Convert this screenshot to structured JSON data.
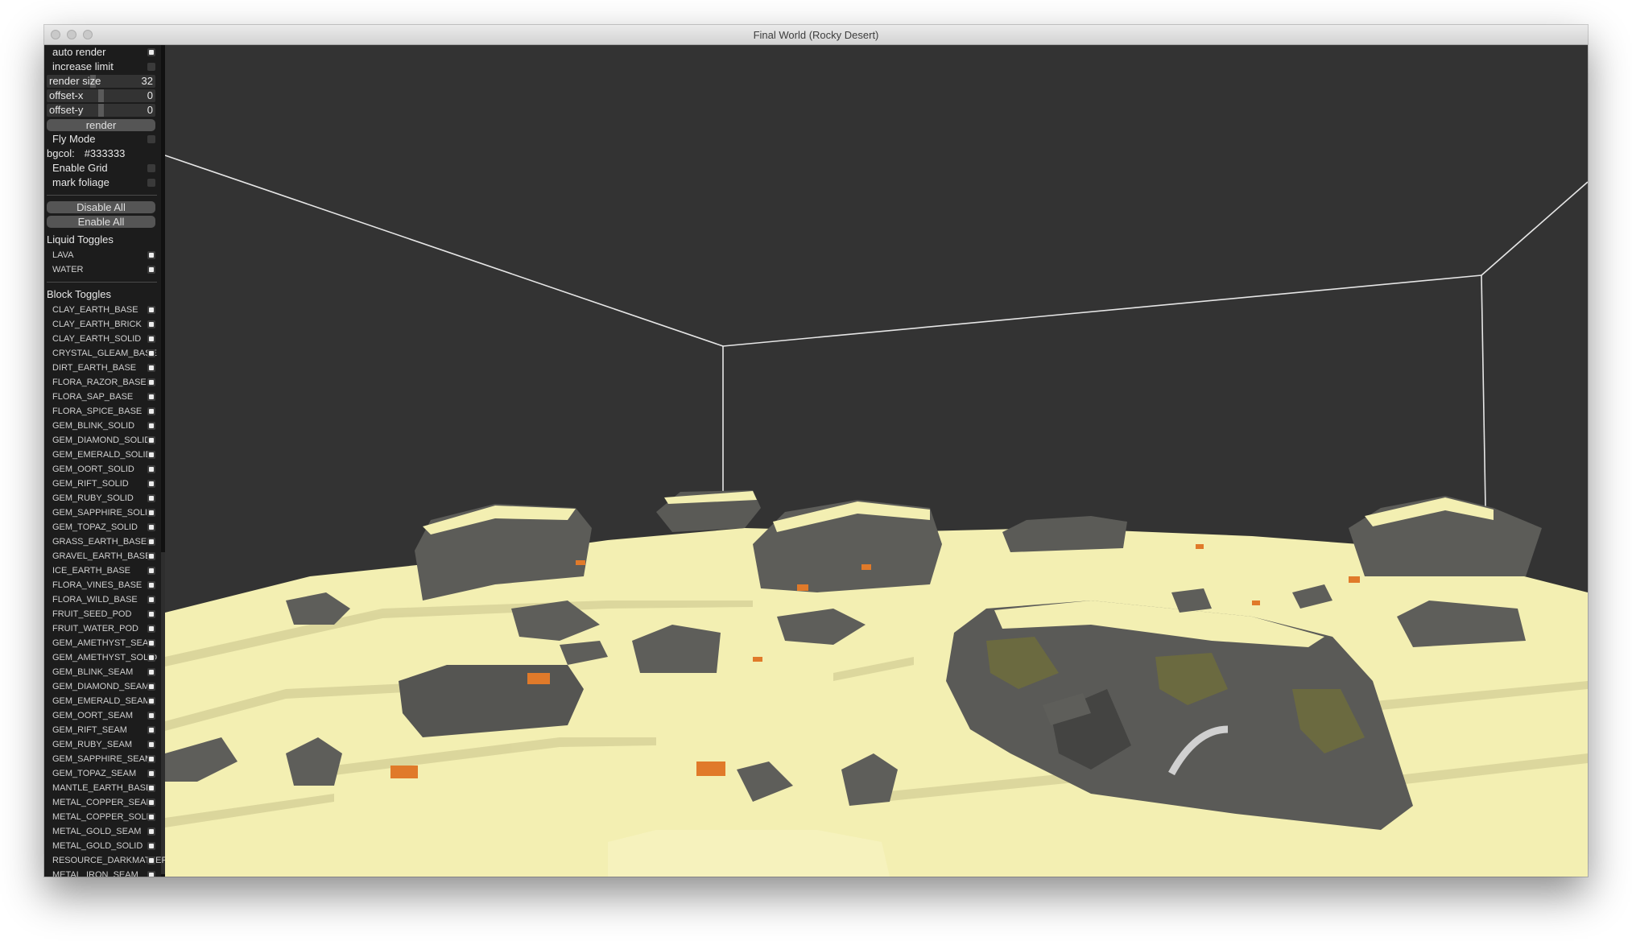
{
  "window": {
    "title": "Final World (Rocky Desert)"
  },
  "controls": {
    "auto_render": {
      "label": "auto render",
      "checked": true
    },
    "increase_limit": {
      "label": "increase limit",
      "checked": false
    },
    "render_size": {
      "label": "render size",
      "value": "32"
    },
    "offset_x": {
      "label": "offset-x",
      "value": "0"
    },
    "offset_y": {
      "label": "offset-y",
      "value": "0"
    },
    "render_button": "render",
    "fly_mode": {
      "label": "Fly Mode",
      "checked": false
    },
    "bgcol": {
      "label": "bgcol:",
      "value": "#333333"
    },
    "enable_grid": {
      "label": "Enable Grid",
      "checked": false
    },
    "mark_foliage": {
      "label": "mark foliage",
      "checked": false
    },
    "disable_all": "Disable All",
    "enable_all": "Enable All"
  },
  "liquid_toggles": {
    "heading": "Liquid Toggles",
    "items": [
      {
        "label": "LAVA",
        "checked": true
      },
      {
        "label": "WATER",
        "checked": true
      }
    ]
  },
  "block_toggles": {
    "heading": "Block Toggles",
    "items": [
      {
        "label": "CLAY_EARTH_BASE",
        "checked": true
      },
      {
        "label": "CLAY_EARTH_BRICK",
        "checked": true
      },
      {
        "label": "CLAY_EARTH_SOLID",
        "checked": true
      },
      {
        "label": "CRYSTAL_GLEAM_BASE",
        "checked": true
      },
      {
        "label": "DIRT_EARTH_BASE",
        "checked": true
      },
      {
        "label": "FLORA_RAZOR_BASE",
        "checked": true
      },
      {
        "label": "FLORA_SAP_BASE",
        "checked": true
      },
      {
        "label": "FLORA_SPICE_BASE",
        "checked": true
      },
      {
        "label": "GEM_BLINK_SOLID",
        "checked": true
      },
      {
        "label": "GEM_DIAMOND_SOLID",
        "checked": true
      },
      {
        "label": "GEM_EMERALD_SOLID",
        "checked": true
      },
      {
        "label": "GEM_OORT_SOLID",
        "checked": true
      },
      {
        "label": "GEM_RIFT_SOLID",
        "checked": true
      },
      {
        "label": "GEM_RUBY_SOLID",
        "checked": true
      },
      {
        "label": "GEM_SAPPHIRE_SOLID",
        "checked": true
      },
      {
        "label": "GEM_TOPAZ_SOLID",
        "checked": true
      },
      {
        "label": "GRASS_EARTH_BASE",
        "checked": true
      },
      {
        "label": "GRAVEL_EARTH_BASE",
        "checked": true
      },
      {
        "label": "ICE_EARTH_BASE",
        "checked": true
      },
      {
        "label": "FLORA_VINES_BASE",
        "checked": true
      },
      {
        "label": "FLORA_WILD_BASE",
        "checked": true
      },
      {
        "label": "FRUIT_SEED_POD",
        "checked": true
      },
      {
        "label": "FRUIT_WATER_POD",
        "checked": true
      },
      {
        "label": "GEM_AMETHYST_SEAM",
        "checked": true
      },
      {
        "label": "GEM_AMETHYST_SOLID",
        "checked": true
      },
      {
        "label": "GEM_BLINK_SEAM",
        "checked": true
      },
      {
        "label": "GEM_DIAMOND_SEAM",
        "checked": true
      },
      {
        "label": "GEM_EMERALD_SEAM",
        "checked": true
      },
      {
        "label": "GEM_OORT_SEAM",
        "checked": true
      },
      {
        "label": "GEM_RIFT_SEAM",
        "checked": true
      },
      {
        "label": "GEM_RUBY_SEAM",
        "checked": true
      },
      {
        "label": "GEM_SAPPHIRE_SEAM",
        "checked": true
      },
      {
        "label": "GEM_TOPAZ_SEAM",
        "checked": true
      },
      {
        "label": "MANTLE_EARTH_BASE",
        "checked": true
      },
      {
        "label": "METAL_COPPER_SEAM",
        "checked": true
      },
      {
        "label": "METAL_COPPER_SOLID",
        "checked": true
      },
      {
        "label": "METAL_GOLD_SEAM",
        "checked": true
      },
      {
        "label": "METAL_GOLD_SOLID",
        "checked": true
      },
      {
        "label": "RESOURCE_DARKMATTER_SEAM",
        "checked": true
      },
      {
        "label": "METAL_IRON_SEAM",
        "checked": true
      }
    ]
  },
  "colors": {
    "background": "#333333",
    "sand": "#f3efb2",
    "rock": "#636363",
    "moss": "#6e6c3c",
    "lava": "#e07a2a",
    "panel": "#1c1c1c"
  }
}
